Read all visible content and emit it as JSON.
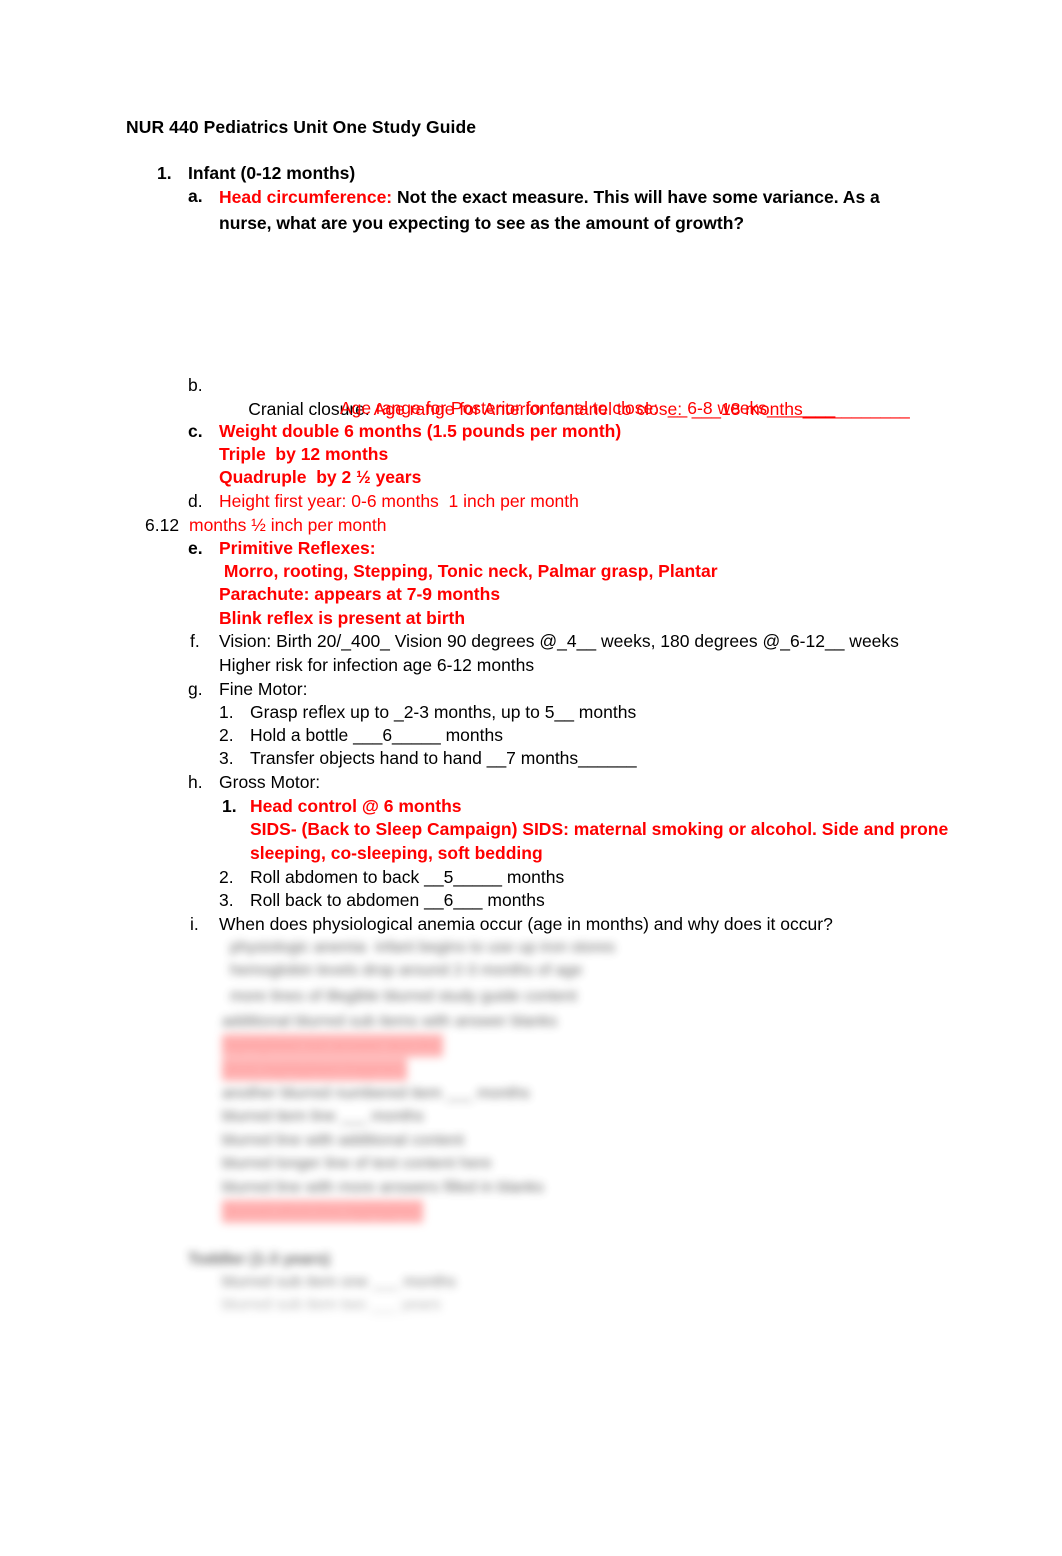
{
  "document": {
    "title": "NUR 440 Pediatrics Unit One Study Guide",
    "accent_red": "#FF0000",
    "text_black": "#000000",
    "background": "#FFFFFF"
  },
  "outline": {
    "item1_marker": "1.",
    "item1_label": "Infant (0-12 months)",
    "a": {
      "marker": "a.",
      "red_lead": "Head circumference:",
      "black_text": "Not the exact measure.  This will have some variance.  As a nurse, what are you expecting to see as the amount of growth?"
    },
    "b": {
      "marker": "b.",
      "black_lead": "Cranial closure.",
      "red_line1": "Age range for Anterior fontanel to close:  ___18 months___________",
      "red_line2": "Age range for Posterior fontanel to close:  __6-8 weeks_______"
    },
    "c": {
      "marker": "c.",
      "line1": "Weight double 6 months (1.5 pounds per month)",
      "line2": "Triple  by 12 months",
      "line3": "Quadruple  by 2 ½ years"
    },
    "d": {
      "marker": "d.",
      "line1": "Height first year: 0-6 months  1 inch per month",
      "overflow_marker": "6.12",
      "overflow_text": "months ½ inch per month"
    },
    "e": {
      "marker": "e.",
      "line1": "Primitive Reflexes:",
      "line2": " Morro, rooting, Stepping, Tonic neck, Palmar grasp, Plantar",
      "line3": "Parachute: appears at 7-9 months",
      "line4": "Blink reflex is present at birth"
    },
    "f": {
      "marker": "f.",
      "line1": "Vision: Birth 20/_400_ Vision 90 degrees @_4__ weeks, 180 degrees @_6-12__ weeks",
      "line2": "Higher risk for infection age 6-12 months"
    },
    "g": {
      "marker": "g.",
      "label": "Fine Motor:",
      "items": [
        {
          "marker": "1.",
          "text": "Grasp reflex up to _2-3 months, up to 5__ months"
        },
        {
          "marker": "2.",
          "text": "Hold a bottle ___6_____ months"
        },
        {
          "marker": "3.",
          "text": "Transfer objects hand to hand __7 months______"
        }
      ]
    },
    "h": {
      "marker": "h.",
      "label": "Gross Motor:",
      "item1_marker": "1.",
      "item1_line1": "Head control @ 6 months",
      "item1_line2": "SIDS- (Back to Sleep Campaign) SIDS: maternal smoking or alcohol. Side and prone",
      "item1_line3": "sleeping, co-sleeping, soft bedding",
      "items": [
        {
          "marker": "2.",
          "text": "Roll abdomen to back __5_____ months"
        },
        {
          "marker": "3.",
          "text": "Roll back to abdomen __6___ months"
        }
      ]
    },
    "i": {
      "marker": "i.",
      "text": "When does physiological anemia occur (age in months) and why does it occur?"
    }
  },
  "obscured_preview": {
    "note": "lower portion of page is blurred and illegible",
    "placeholder_lines": [
      "physiologic anemia  infant begins to use up iron stores",
      "hemoglobin levels drop around 2-3 months of age",
      "more lines of illegible blurred study guide content",
      "additional blurred sub items with answer blanks",
      "highlighted red answer text line",
      "short highlighted fragment",
      "another blurred numbered item ___ months",
      "blurred item line ___ months",
      "blurred line with additional content",
      "blurred longer line of text content here",
      "blurred line with more answers filled in blanks",
      "blurred short line highlighted"
    ],
    "placeholder_heading": "Toddler (1-3 years)",
    "placeholder_sub": [
      "blurred sub item one ___ months",
      "blurred sub item two ___ years"
    ]
  }
}
